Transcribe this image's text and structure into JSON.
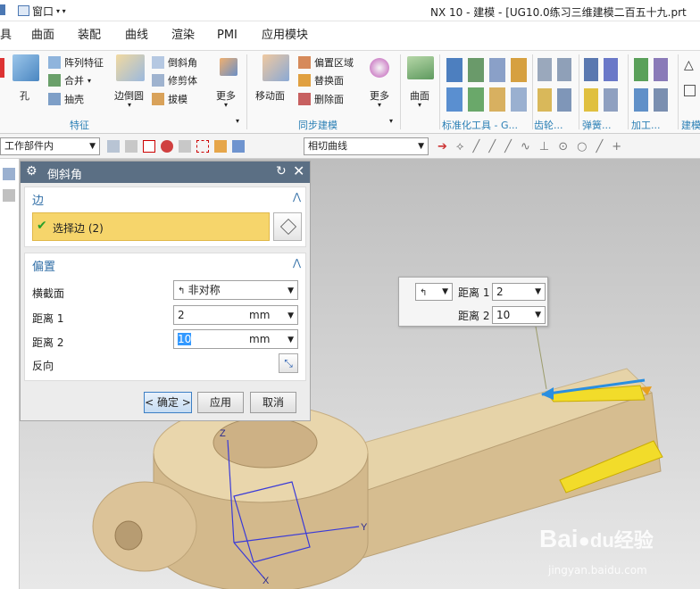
{
  "titlebar": {
    "window_menu": "窗口",
    "title": "NX 10 - 建模 - [UG10.0练习三维建模二百五十九.prt"
  },
  "menubar": {
    "items": [
      "具",
      "曲面",
      "装配",
      "曲线",
      "渲染",
      "PMI",
      "应用模块"
    ]
  },
  "ribbon": {
    "hole": "孔",
    "pattern": "阵列特征",
    "combine": "合并",
    "extract": "抽壳",
    "edge_blend": "边倒圆",
    "chamfer": "倒斜角",
    "trim_body": "修剪体",
    "draft": "拔模",
    "more1": "更多",
    "group_feature": "特征",
    "move_face": "移动面",
    "offset_region": "偏置区域",
    "replace_face": "替换面",
    "delete_face": "删除面",
    "more2": "更多",
    "group_sync": "同步建模",
    "surface": "曲面",
    "group_std": "标准化工具 - G...",
    "group_gear": "齿轮...",
    "group_spring": "弹簧...",
    "group_machining": "加工...",
    "group_build": "建模"
  },
  "toolbar": {
    "scope": "工作部件内",
    "curve_rule": "相切曲线"
  },
  "dialog": {
    "title": "倒斜角",
    "edge_section": "边",
    "select_edge": "选择边 (2)",
    "offset_section": "偏置",
    "cross_section_label": "横截面",
    "cross_section_value": "非对称",
    "dist1_label": "距离 1",
    "dist1_value": "2",
    "dist1_unit": "mm",
    "dist2_label": "距离 2",
    "dist2_value": "10",
    "dist2_unit": "mm",
    "reverse_label": "反向",
    "ok": "< 确定 >",
    "apply": "应用",
    "cancel": "取消"
  },
  "popup": {
    "dist1_label": "距离 1",
    "dist1_value": "2",
    "dist2_label": "距离 2",
    "dist2_value": "10"
  },
  "axes": {
    "x": "X",
    "y": "Y",
    "z": "Z"
  },
  "watermark": {
    "brand": "Bai",
    "brand_cn": "经验",
    "url": "jingyan.baidu.com"
  },
  "colors": {
    "accent": "#2f6da6",
    "selection": "#f6d56b",
    "part": "#e4cfa4",
    "chamfer_face": "#f2dc2a"
  }
}
